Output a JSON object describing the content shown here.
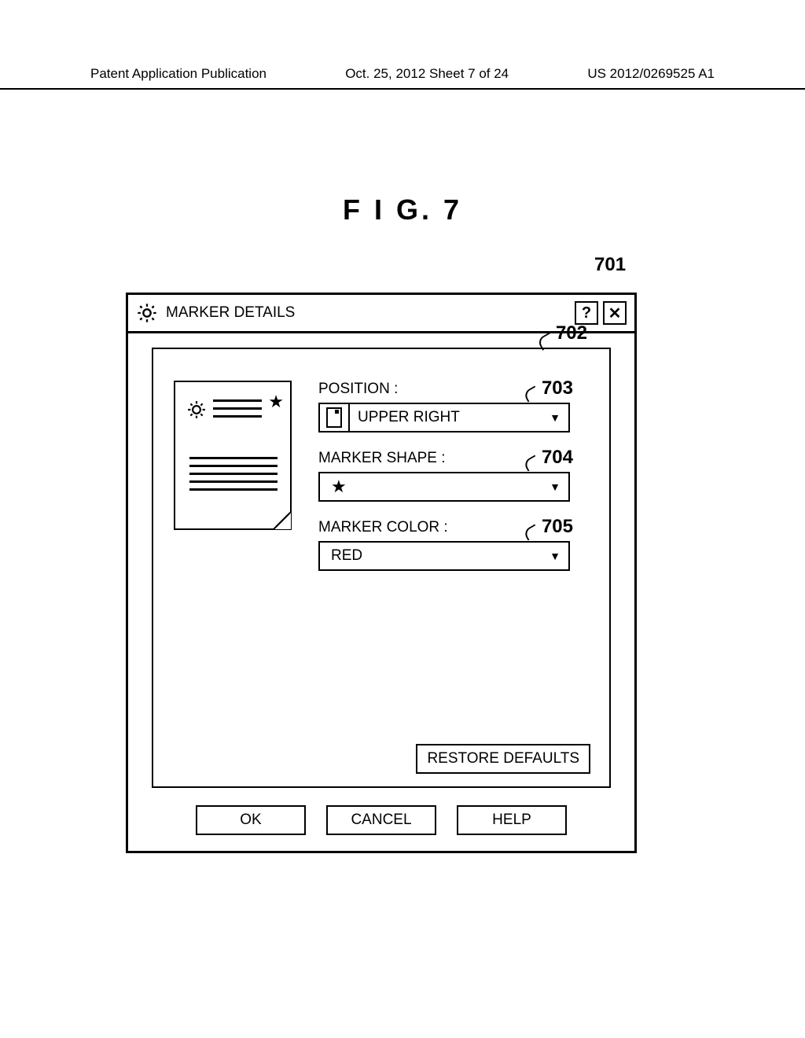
{
  "header": {
    "left": "Patent Application Publication",
    "center": "Oct. 25, 2012  Sheet 7 of 24",
    "right": "US 2012/0269525 A1"
  },
  "figure_title": "F I G.   7",
  "callouts": {
    "c701": "701",
    "c702": "702",
    "c703": "703",
    "c704": "704",
    "c705": "705"
  },
  "dialog": {
    "title": "MARKER DETAILS",
    "help_btn": "?",
    "close_btn": "✕",
    "fields": {
      "position": {
        "label": "POSITION :",
        "value": "UPPER RIGHT"
      },
      "shape": {
        "label": "MARKER SHAPE :",
        "value": "★"
      },
      "color": {
        "label": "MARKER COLOR :",
        "value": "RED"
      }
    },
    "restore": "RESTORE DEFAULTS",
    "buttons": {
      "ok": "OK",
      "cancel": "CANCEL",
      "help": "HELP"
    }
  }
}
